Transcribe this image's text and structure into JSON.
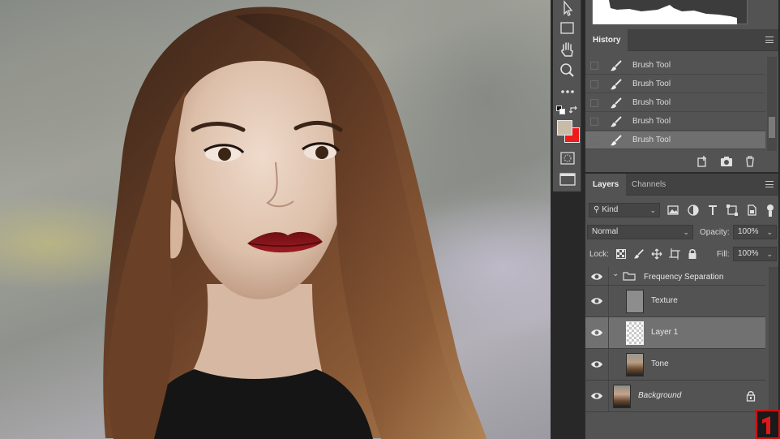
{
  "history": {
    "tab_label": "History",
    "items": [
      {
        "label": "Brush Tool",
        "selected": false
      },
      {
        "label": "Brush Tool",
        "selected": false
      },
      {
        "label": "Brush Tool",
        "selected": false
      },
      {
        "label": "Brush Tool",
        "selected": false
      },
      {
        "label": "Brush Tool",
        "selected": true
      }
    ]
  },
  "layers_panel": {
    "tabs": [
      {
        "label": "Layers",
        "active": true
      },
      {
        "label": "Channels",
        "active": false
      }
    ],
    "filter_kind": "Kind",
    "blend_mode": "Normal",
    "opacity_label": "Opacity:",
    "opacity_value": "100%",
    "lock_label": "Lock:",
    "fill_label": "Fill:",
    "fill_value": "100%",
    "layers": [
      {
        "name": "Frequency Separation",
        "type": "group",
        "selected": false
      },
      {
        "name": "Texture",
        "type": "layer",
        "selected": false
      },
      {
        "name": "Layer 1",
        "type": "layer",
        "selected": true
      },
      {
        "name": "Tone",
        "type": "layer",
        "selected": false
      },
      {
        "name": "Background",
        "type": "background",
        "selected": false,
        "locked": true
      }
    ]
  },
  "colors": {
    "foreground": "#c8bca8",
    "background": "#ee1b1b",
    "panel": "#535353",
    "selected_row": "#717171"
  },
  "toolbar_icons": [
    "move-arrow-icon",
    "rectangle-marquee-icon",
    "hand-icon",
    "zoom-icon",
    "more-tools-icon",
    "default-colors-icon",
    "swap-colors-icon",
    "quick-mask-icon",
    "screen-mode-icon"
  ]
}
